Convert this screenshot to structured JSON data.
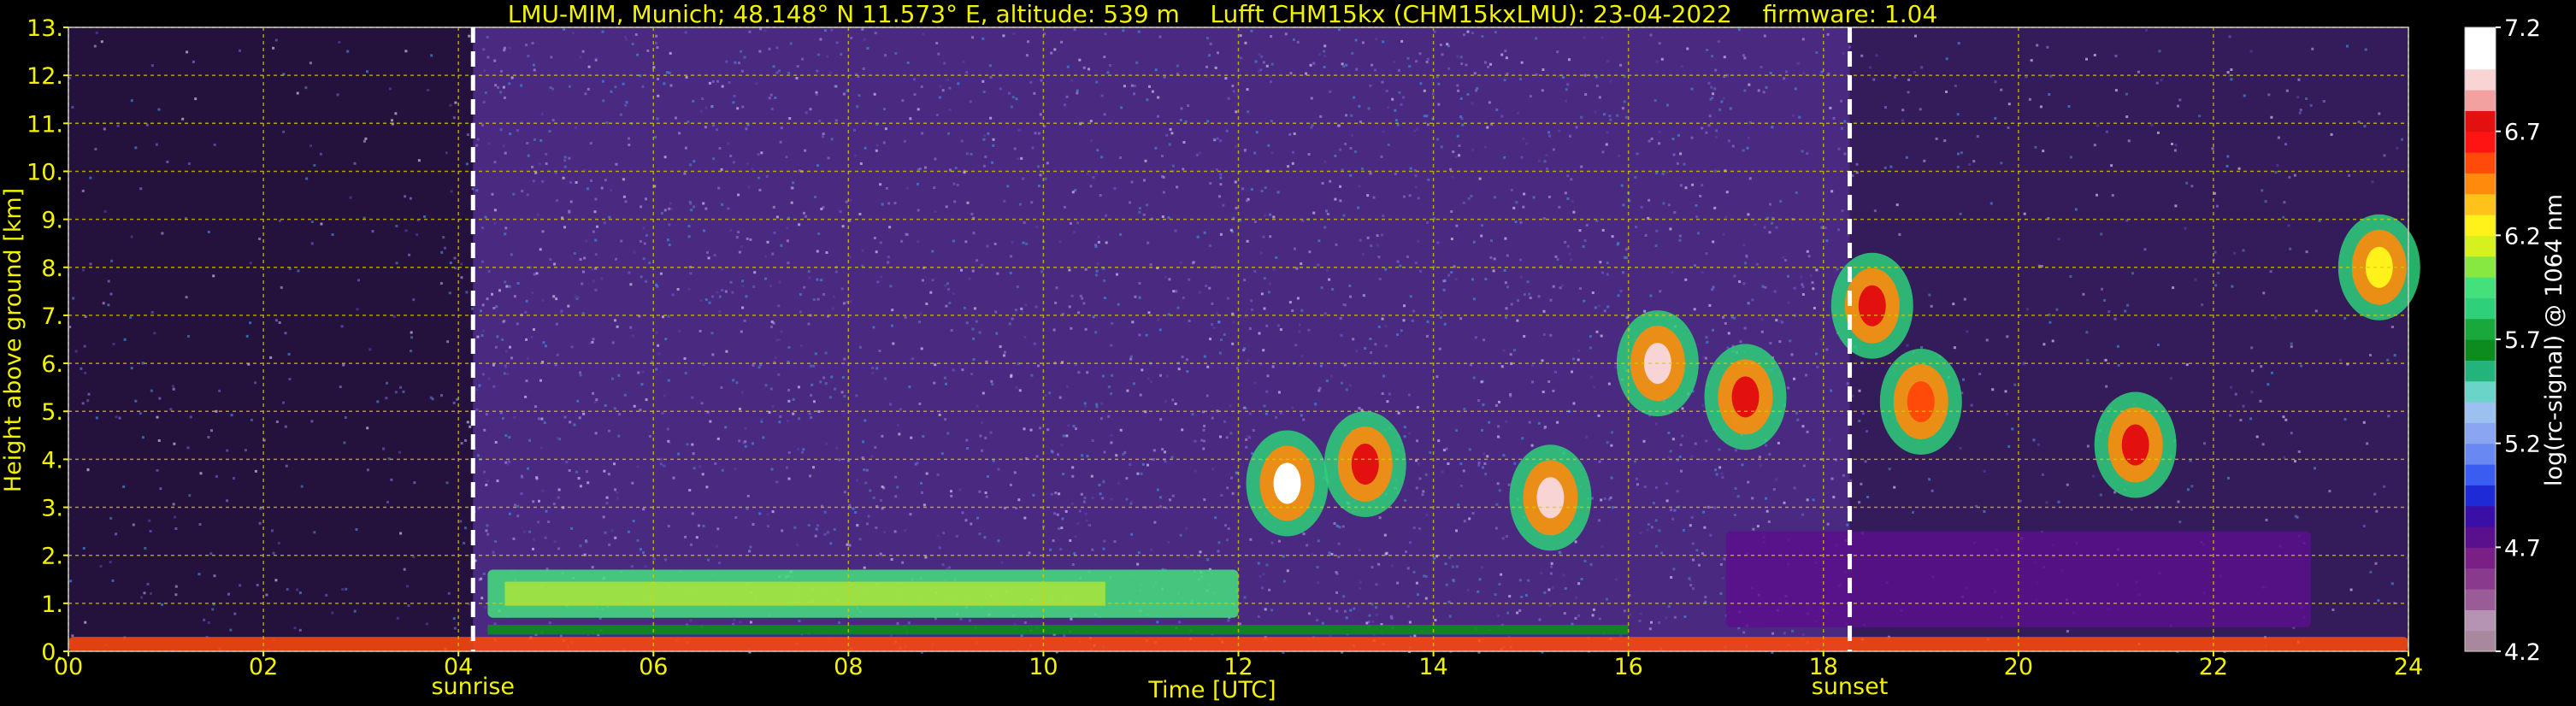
{
  "chart_data": {
    "type": "heatmap",
    "title": "LMU-MIM, Munich; 48.148° N 11.573° E, altitude: 539 m    Lufft CHM15kx (CHM15kxLMU): 23-04-2022    firmware: 1.04",
    "xlabel": "Time [UTC]",
    "ylabel": "Height above ground [km]",
    "xlim": [
      0,
      24
    ],
    "ylim": [
      0,
      13
    ],
    "x_ticks": [
      "00",
      "02",
      "04",
      "06",
      "08",
      "10",
      "12",
      "14",
      "16",
      "18",
      "20",
      "22",
      "24"
    ],
    "y_ticks": [
      "0.",
      "1.",
      "2.",
      "3.",
      "4.",
      "5.",
      "6.",
      "7.",
      "8.",
      "9.",
      "10.",
      "11.",
      "12.",
      "13."
    ],
    "grid": true,
    "colorbar": {
      "label": "log(rc-signal) @ 1064 nm",
      "range": [
        4.2,
        7.2
      ],
      "ticks": [
        "4.2",
        "4.7",
        "5.2",
        "5.7",
        "6.2",
        "6.7",
        "7.2"
      ],
      "colors": [
        "#a8889c",
        "#b493b3",
        "#9a5c96",
        "#8a3a8c",
        "#7a1f85",
        "#5a0f8c",
        "#3a0fa8",
        "#1e2ad6",
        "#3a5cf0",
        "#6a88f2",
        "#8aa6f2",
        "#9cc0f0",
        "#6ad4c8",
        "#22b47a",
        "#0c8c1e",
        "#18a83c",
        "#2ed07a",
        "#44e07c",
        "#86e840",
        "#d6f21e",
        "#fff21a",
        "#ffc21a",
        "#ff8a0c",
        "#ff4a0a",
        "#ff1414",
        "#e31010",
        "#f2a0a0",
        "#f8d4d4",
        "#ffffff",
        "#ffffff"
      ]
    },
    "markers": [
      {
        "label": "sunrise",
        "time": 4.15
      },
      {
        "label": "sunset",
        "time": 18.27
      }
    ],
    "features": [
      {
        "name": "surface layer",
        "t_start": 0,
        "t_end": 24,
        "h_bottom": 0.0,
        "h_top": 0.3,
        "level": 6.6
      },
      {
        "name": "boundary layer aerosol",
        "t_start": 4.3,
        "t_end": 12.0,
        "h_bottom": 0.7,
        "h_top": 1.7,
        "level": 5.9
      },
      {
        "name": "evening residual layer",
        "t_start": 17.0,
        "t_end": 23.0,
        "h_bottom": 0.5,
        "h_top": 2.5,
        "level": 4.8
      },
      {
        "name": "cloud",
        "t_center": 12.5,
        "h_center": 3.5,
        "level": 7.2
      },
      {
        "name": "cloud",
        "t_center": 13.3,
        "h_center": 3.9,
        "level": 6.8
      },
      {
        "name": "cloud",
        "t_center": 15.2,
        "h_center": 3.2,
        "level": 6.9
      },
      {
        "name": "cloud",
        "t_center": 16.3,
        "h_center": 6.0,
        "level": 6.9
      },
      {
        "name": "cloud",
        "t_center": 17.2,
        "h_center": 5.3,
        "level": 6.7
      },
      {
        "name": "cloud",
        "t_center": 18.5,
        "h_center": 7.2,
        "level": 6.7
      },
      {
        "name": "cloud",
        "t_center": 19.0,
        "h_center": 5.2,
        "level": 6.6
      },
      {
        "name": "cloud",
        "t_center": 21.2,
        "h_center": 4.3,
        "level": 6.8
      },
      {
        "name": "cloud",
        "t_center": 23.7,
        "h_center": 8.0,
        "level": 6.3
      }
    ]
  }
}
